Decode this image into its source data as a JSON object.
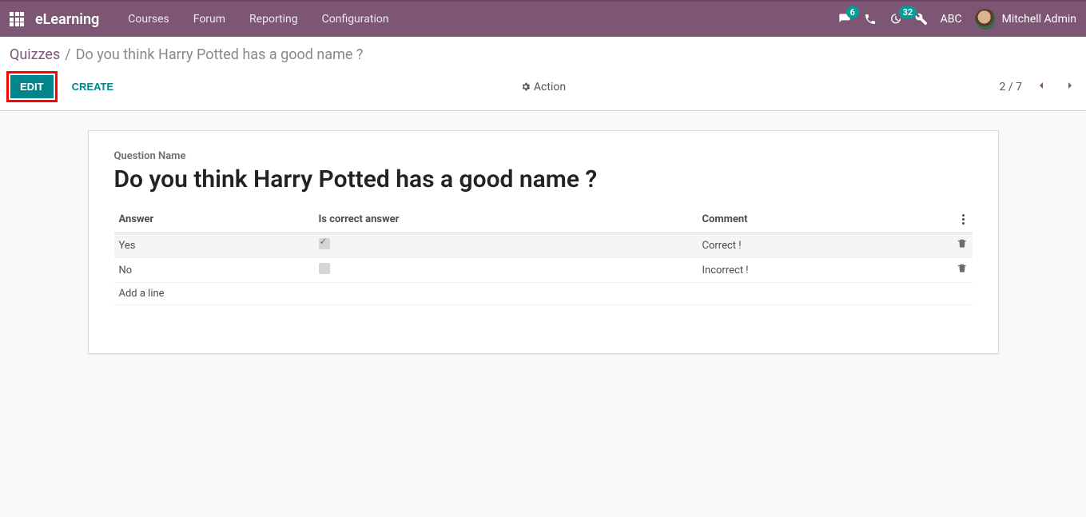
{
  "topnav": {
    "brand": "eLearning",
    "items": [
      "Courses",
      "Forum",
      "Reporting",
      "Configuration"
    ],
    "messages_badge": "6",
    "activities_badge": "32",
    "company": "ABC",
    "user_name": "Mitchell Admin"
  },
  "breadcrumb": {
    "parent": "Quizzes",
    "current": "Do you think Harry Potted has a good name ?"
  },
  "controls": {
    "edit": "Edit",
    "create": "Create",
    "action": "Action",
    "pager": "2 / 7"
  },
  "form": {
    "question_label": "Question Name",
    "question_value": "Do you think Harry Potted has a good name ?",
    "columns": {
      "answer": "Answer",
      "correct": "Is correct answer",
      "comment": "Comment"
    },
    "rows": [
      {
        "answer": "Yes",
        "correct": true,
        "comment": "Correct !"
      },
      {
        "answer": "No",
        "correct": false,
        "comment": "Incorrect !"
      }
    ],
    "add_line": "Add a line"
  }
}
